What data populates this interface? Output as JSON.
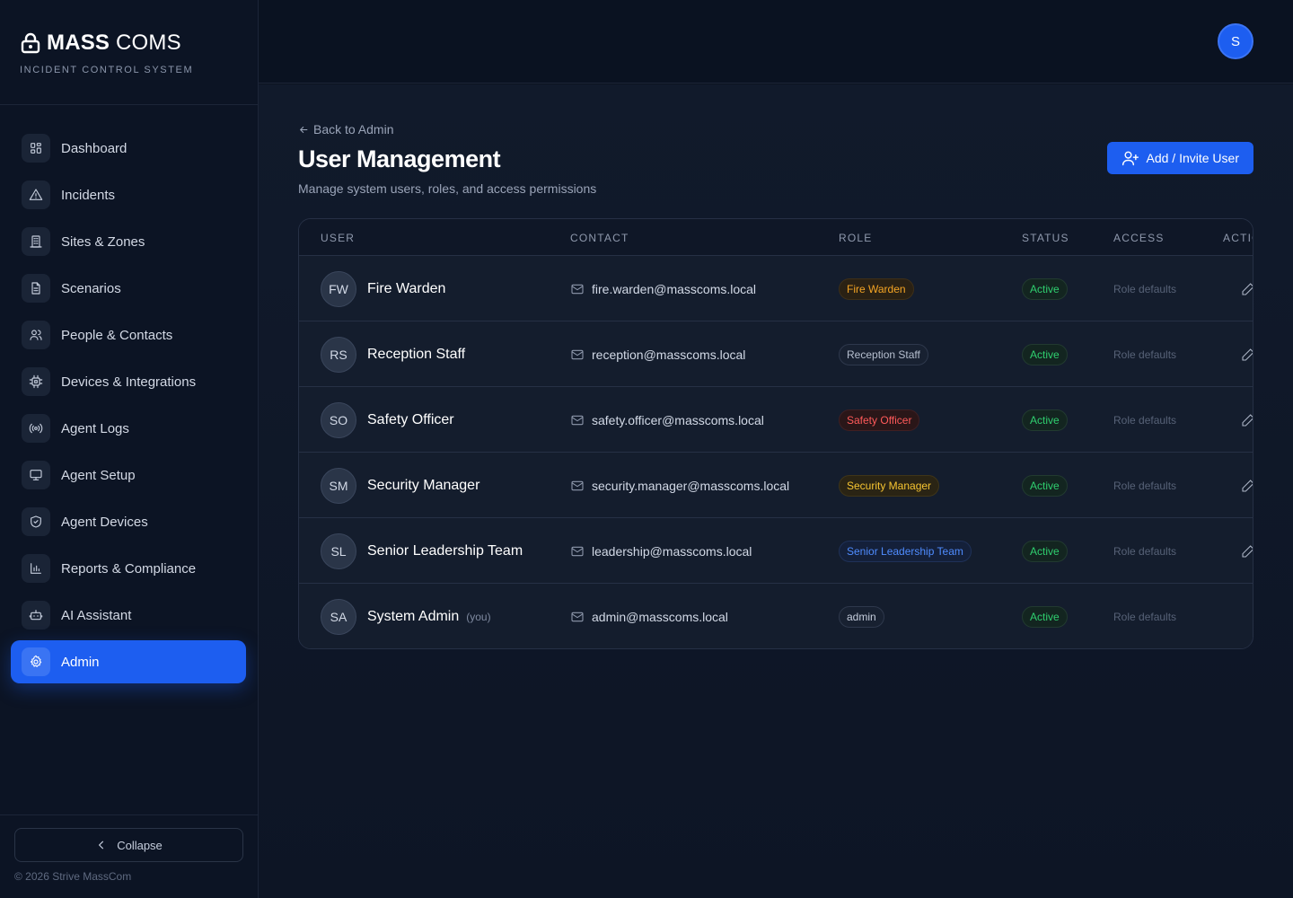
{
  "brand": {
    "name_bold": "MASS",
    "name_light": "COMS",
    "subtitle": "INCIDENT CONTROL SYSTEM"
  },
  "sidebar": {
    "items": [
      {
        "label": "Dashboard",
        "icon": "dashboard-icon"
      },
      {
        "label": "Incidents",
        "icon": "alert-triangle-icon"
      },
      {
        "label": "Sites & Zones",
        "icon": "building-icon"
      },
      {
        "label": "Scenarios",
        "icon": "file-text-icon"
      },
      {
        "label": "People & Contacts",
        "icon": "users-icon"
      },
      {
        "label": "Devices & Integrations",
        "icon": "cpu-icon"
      },
      {
        "label": "Agent Logs",
        "icon": "radio-icon"
      },
      {
        "label": "Agent Setup",
        "icon": "monitor-icon"
      },
      {
        "label": "Agent Devices",
        "icon": "shield-icon"
      },
      {
        "label": "Reports & Compliance",
        "icon": "bar-chart-icon"
      },
      {
        "label": "AI Assistant",
        "icon": "bot-icon"
      },
      {
        "label": "Admin",
        "icon": "gear-icon",
        "active": true
      }
    ],
    "collapse_label": "Collapse",
    "copyright": "© 2026 Strive MassCom"
  },
  "topbar": {
    "avatar_initial": "S"
  },
  "page": {
    "back_label": "Back to Admin",
    "title": "User Management",
    "subtitle": "Manage system users, roles, and access permissions",
    "add_button": "Add / Invite User"
  },
  "table": {
    "headers": {
      "user": "USER",
      "contact": "CONTACT",
      "role": "ROLE",
      "status": "STATUS",
      "access": "ACCESS",
      "actions": "ACTIONS"
    },
    "rows": [
      {
        "initials": "FW",
        "name": "Fire Warden",
        "you": "",
        "email": "fire.warden@masscoms.local",
        "role": "Fire Warden",
        "role_color": "#f5a524",
        "role_bg": "#2a2114",
        "role_border": "#3d2f18",
        "status": "Active",
        "access": "Role defaults",
        "editable": true
      },
      {
        "initials": "RS",
        "name": "Reception Staff",
        "you": "",
        "email": "reception@masscoms.local",
        "role": "Reception Staff",
        "role_color": "#b6bfcf",
        "role_bg": "#182131",
        "role_border": "#2e384c",
        "status": "Active",
        "access": "Role defaults",
        "editable": true
      },
      {
        "initials": "SO",
        "name": "Safety Officer",
        "you": "",
        "email": "safety.officer@masscoms.local",
        "role": "Safety Officer",
        "role_color": "#ff5a5a",
        "role_bg": "#2a1618",
        "role_border": "#3f1f22",
        "status": "Active",
        "access": "Role defaults",
        "editable": true
      },
      {
        "initials": "SM",
        "name": "Security Manager",
        "you": "",
        "email": "security.manager@masscoms.local",
        "role": "Security Manager",
        "role_color": "#f7c531",
        "role_bg": "#2a2414",
        "role_border": "#3f3518",
        "status": "Active",
        "access": "Role defaults",
        "editable": true
      },
      {
        "initials": "SL",
        "name": "Senior Leadership Team",
        "you": "",
        "email": "leadership@masscoms.local",
        "role": "Senior Leadership Team",
        "role_color": "#4f8cff",
        "role_bg": "#14203a",
        "role_border": "#1f3158",
        "status": "Active",
        "access": "Role defaults",
        "editable": true
      },
      {
        "initials": "SA",
        "name": "System Admin",
        "you": "(you)",
        "email": "admin@masscoms.local",
        "role": "admin",
        "role_color": "#c6cedd",
        "role_bg": "#182131",
        "role_border": "#2e384c",
        "status": "Active",
        "access": "Role defaults",
        "editable": false
      }
    ]
  }
}
